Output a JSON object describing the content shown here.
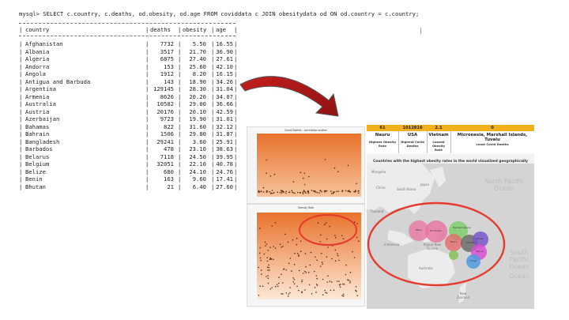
{
  "terminal": {
    "query": "mysql> SELECT c.country, c.deaths, od.obesity, od.age FROM coviddata c JOIN obesitydata od ON od.country = c.country;",
    "columns": [
      "country",
      "deaths",
      "obesity",
      "age"
    ],
    "rows": [
      [
        "Afghanistan",
        "7732",
        "5.50",
        "16.55"
      ],
      [
        "Albania",
        "3517",
        "21.70",
        "36.90"
      ],
      [
        "Algeria",
        "6875",
        "27.40",
        "27.61"
      ],
      [
        "Andorra",
        "153",
        "25.60",
        "42.10"
      ],
      [
        "Angola",
        "1912",
        "8.20",
        "16.15"
      ],
      [
        "Antigua and Barbuda",
        "143",
        "18.90",
        "34.26"
      ],
      [
        "Argentina",
        "129145",
        "28.30",
        "31.04"
      ],
      [
        "Armenia",
        "8626",
        "20.20",
        "34.07"
      ],
      [
        "Australia",
        "10582",
        "29.00",
        "36.66"
      ],
      [
        "Austria",
        "20176",
        "20.10",
        "42.59"
      ],
      [
        "Azerbaijan",
        "9723",
        "19.90",
        "31.01"
      ],
      [
        "Bahamas",
        "822",
        "31.60",
        "32.12"
      ],
      [
        "Bahrain",
        "1506",
        "29.80",
        "31.87"
      ],
      [
        "Bangladesh",
        "29241",
        "3.60",
        "25.91"
      ],
      [
        "Barbados",
        "478",
        "23.10",
        "38.63"
      ],
      [
        "Belarus",
        "7118",
        "24.50",
        "39.95"
      ],
      [
        "Belgium",
        "32051",
        "22.10",
        "40.78"
      ],
      [
        "Belize",
        "680",
        "24.10",
        "24.76"
      ],
      [
        "Benin",
        "163",
        "9.60",
        "17.41"
      ],
      [
        "Bhutan",
        "21",
        "6.40",
        "27.60"
      ]
    ]
  },
  "kpi": {
    "values": [
      "61",
      "1012816",
      "2.1",
      "0"
    ],
    "names": [
      "Nauru",
      "USA",
      "Vietnam",
      "Micronesia, Marshall Islands, Tuvalu"
    ],
    "labels": [
      "Highest Obesity Rate",
      "Highest Covid Deaths",
      "Lowest Obesity Rate",
      "Least Covid Deaths"
    ],
    "band_color": "#f2b11a"
  },
  "map": {
    "title": "Countries with the highest obesity rates in the world visualized geographically",
    "labels": {
      "mongolia": "Mongolia",
      "china": "China",
      "south_korea": "South Korea",
      "japan": "Japan",
      "thailand": "Thailand",
      "indonesia": "Indonesia",
      "papua": "Papua New Guinea",
      "australia": "Australia",
      "new_zealand": "New Zealand",
      "north_pacific": "North Pacific Ocean",
      "south_pacific": "South Pacific Ocean",
      "ocean_right": "Ocean"
    },
    "bubbles": [
      "Palau",
      "Micronesia",
      "Marshall Islands",
      "Nauru",
      "Kiribati",
      "Tuvalu",
      "Samoa",
      "Tonga"
    ]
  },
  "charts": {
    "top_title": "Covid Deaths - correlation scatter",
    "bottom_title": "Obesity Rate",
    "gradient_top": "#e9722c",
    "gradient_bottom": "#fbe3cf",
    "highlight_color": "#e53b2c"
  }
}
